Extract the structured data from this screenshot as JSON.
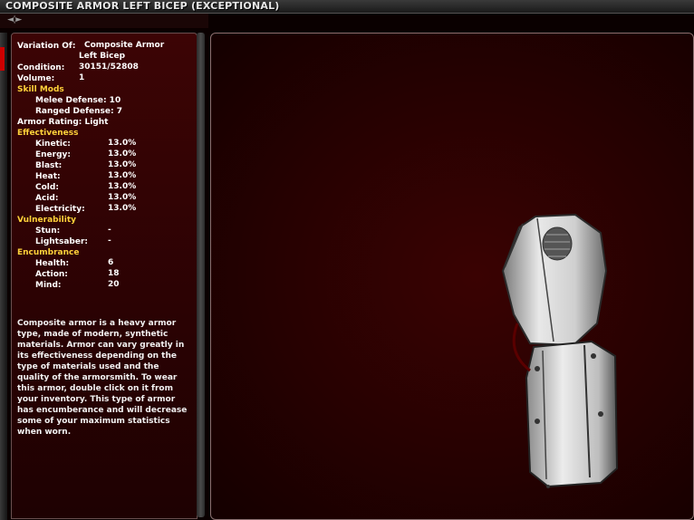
{
  "window": {
    "title": "COMPOSITE ARMOR LEFT BICEP (EXCEPTIONAL)"
  },
  "nav": {
    "arrows": "◄◊►"
  },
  "attributes": {
    "variation_label": "Variation Of:",
    "variation_value_1": "Composite Armor",
    "variation_value_2": "Left Bicep",
    "condition_label": "Condition:",
    "condition_value": "30151/52808",
    "volume_label": "Volume:",
    "volume_value": "1",
    "skill_mods_header": "Skill Mods",
    "melee_defense": "Melee Defense:  10",
    "ranged_defense": "Ranged Defense:  7",
    "armor_rating": "Armor Rating:  Light",
    "effectiveness_header": "Effectiveness",
    "effectiveness": [
      {
        "label": "Kinetic:",
        "value": "13.0%"
      },
      {
        "label": "Energy:",
        "value": "13.0%"
      },
      {
        "label": "Blast:",
        "value": "13.0%"
      },
      {
        "label": "Heat:",
        "value": "13.0%"
      },
      {
        "label": "Cold:",
        "value": "13.0%"
      },
      {
        "label": "Acid:",
        "value": "13.0%"
      },
      {
        "label": "Electricity:",
        "value": "13.0%"
      }
    ],
    "vulnerability_header": "Vulnerability",
    "vulnerability": [
      {
        "label": "Stun:",
        "value": "-"
      },
      {
        "label": "Lightsaber:",
        "value": "-"
      }
    ],
    "encumbrance_header": "Encumbrance",
    "encumbrance": [
      {
        "label": "Health:",
        "value": "6"
      },
      {
        "label": "Action:",
        "value": "18"
      },
      {
        "label": "Mind:",
        "value": "20"
      }
    ]
  },
  "description": "Composite armor is a heavy armor type, made of modern, synthetic materials. Armor can vary greatly in its effectiveness depending on the type of materials used and the quality of the armorsmith. To wear this armor, double click on it from your inventory. This type of armor has encumberance and will decrease some of your maximum statistics when worn.",
  "colors": {
    "header": "#ffd23a",
    "panel_bg": "#3c0405",
    "viewer_bg": "#260101"
  }
}
